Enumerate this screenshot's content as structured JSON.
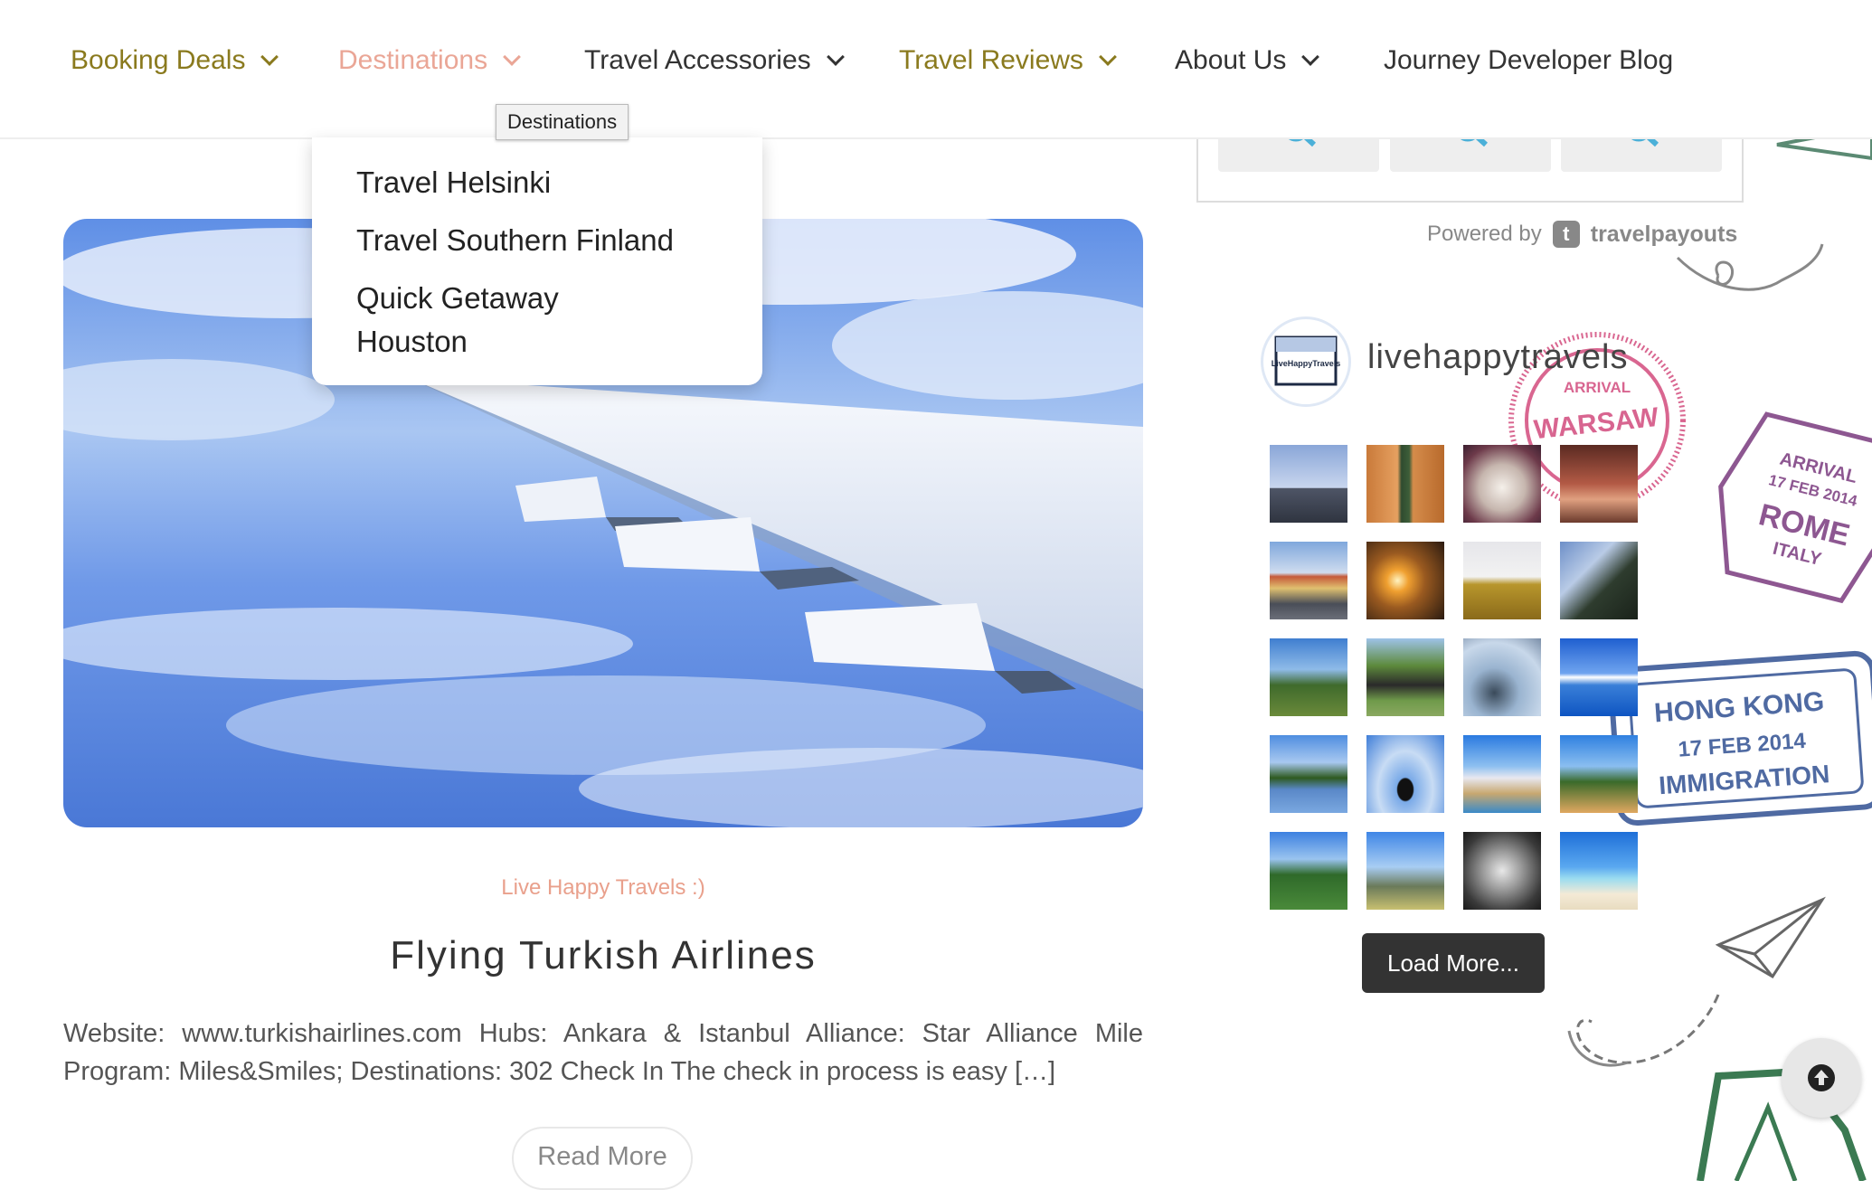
{
  "nav": {
    "items": [
      {
        "label": "Booking Deals",
        "color": "#8a7a1e"
      },
      {
        "label": "Destinations",
        "color": "#eaa696"
      },
      {
        "label": "Travel Accessories",
        "color": "#333333"
      },
      {
        "label": "Travel Reviews",
        "color": "#8a7a1e"
      },
      {
        "label": "About Us",
        "color": "#333333"
      },
      {
        "label": "Journey Developer Blog",
        "color": "#333333"
      }
    ],
    "tooltip": "Destinations"
  },
  "dropdown": {
    "items": [
      "Travel Helsinki",
      "Travel Southern Finland",
      "Quick Getaway",
      "Houston"
    ]
  },
  "post": {
    "category": "Live Happy Travels :)",
    "title": "Flying Turkish Airlines",
    "excerpt": "Website: www.turkishairlines.com Hubs: Ankara & Istanbul Alliance: Star Alliance Mile Program: Miles&Smiles; Destinations: 302 Check In The check in process is easy […]",
    "read_more": "Read More"
  },
  "sidebar": {
    "powered_by": "Powered by",
    "powered_brand": "travelpayouts",
    "instagram_handle": "livehappytravels",
    "avatar_text": "LiveHappyTravels",
    "load_more": "Load More..."
  },
  "stamps": {
    "warsaw": [
      "ARRIVAL",
      "WARSAW"
    ],
    "rome": [
      "ARRIVAL",
      "17 FEB 2014",
      "ROME",
      "ITALY"
    ],
    "hongkong": [
      "HONG KONG",
      "17 FEB 2014",
      "IMMIGRATION"
    ]
  },
  "colors": {
    "accent_olive": "#8a7a1e",
    "accent_salmon": "#eaa696",
    "text": "#333333",
    "button_dark": "#333333"
  },
  "icons": {
    "search": "search-icon",
    "scroll_top": "arrow-up-circle-icon",
    "dropdown": "chevron-down-icon"
  }
}
